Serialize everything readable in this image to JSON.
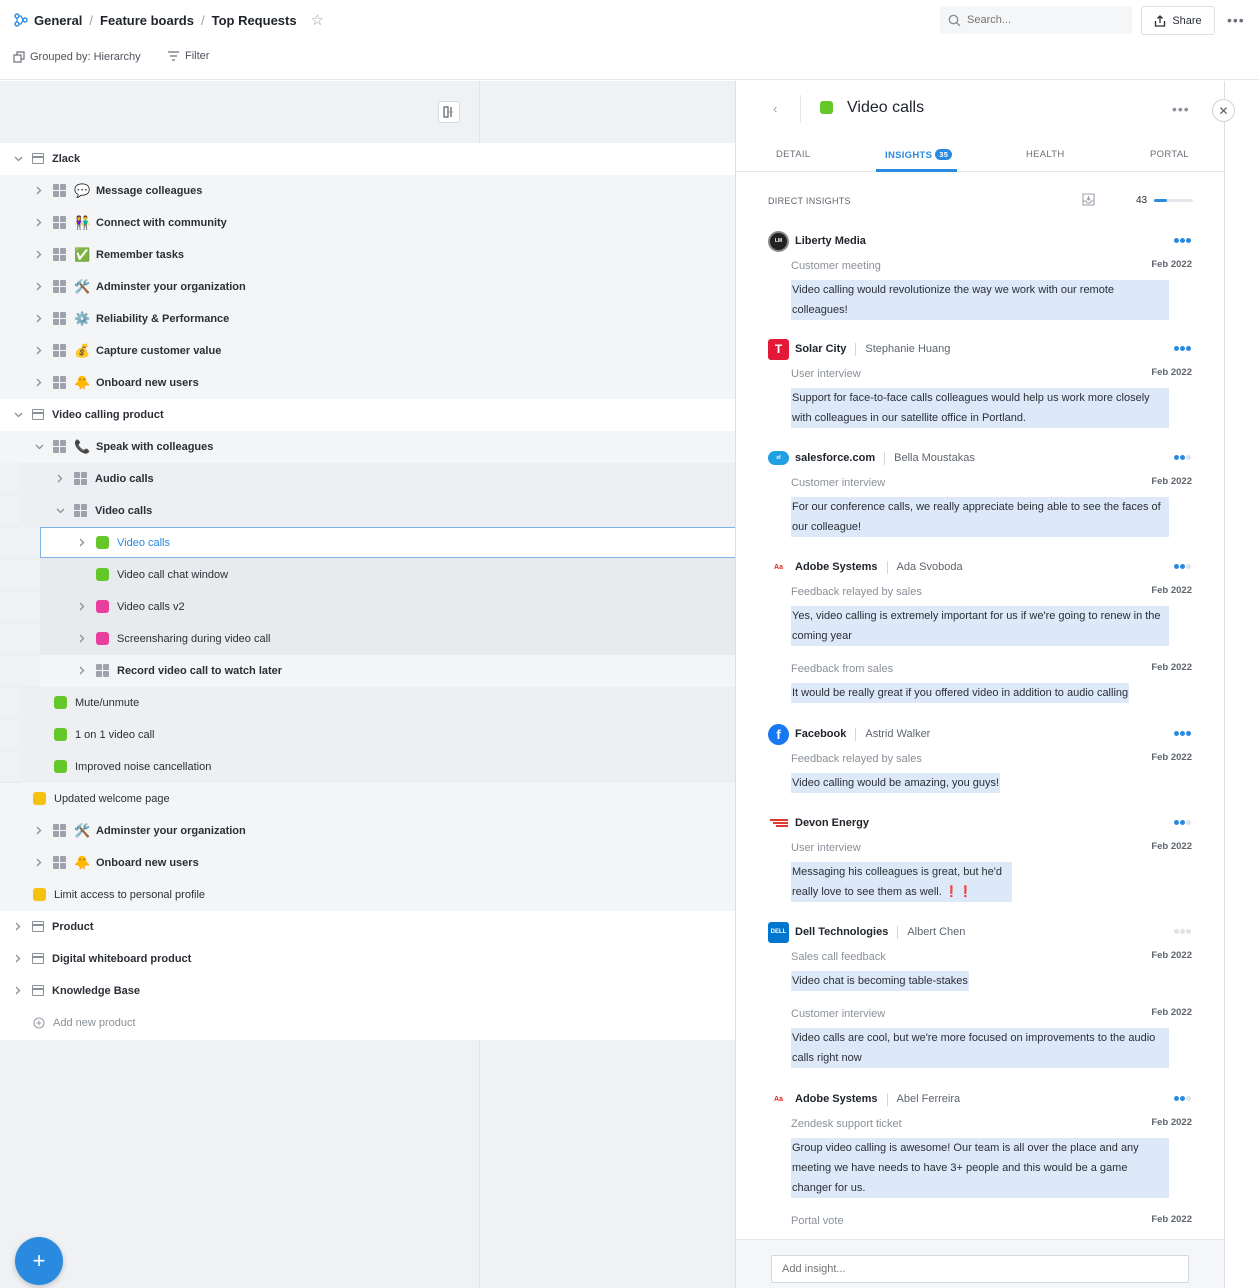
{
  "breadcrumb": [
    "General",
    "Feature boards",
    "Top Requests"
  ],
  "search": {
    "placeholder": "Search..."
  },
  "share_label": "Share",
  "grouped_label": "Grouped by: Hierarchy",
  "filter_label": "Filter",
  "tree": [
    {
      "label": "Zlack",
      "kind": "product",
      "depth": 0,
      "expanded": true,
      "bold": true
    },
    {
      "label": "Message colleagues",
      "kind": "component",
      "icon": "💬",
      "depth": 1,
      "bold": true
    },
    {
      "label": "Connect with community",
      "kind": "component",
      "icon": "👫",
      "depth": 1,
      "bold": true
    },
    {
      "label": "Remember tasks",
      "kind": "component",
      "icon": "✅",
      "depth": 1,
      "bold": true
    },
    {
      "label": "Adminster your organization",
      "kind": "component",
      "icon": "🛠️",
      "depth": 1,
      "bold": true
    },
    {
      "label": "Reliability & Performance",
      "kind": "component",
      "icon": "⚙️",
      "depth": 1,
      "bold": true
    },
    {
      "label": "Capture customer value",
      "kind": "component",
      "icon": "💰",
      "depth": 1,
      "bold": true
    },
    {
      "label": "Onboard new users",
      "kind": "component",
      "icon": "🐥",
      "depth": 1,
      "bold": true
    },
    {
      "label": "Video calling product",
      "kind": "product",
      "depth": 0,
      "expanded": true,
      "bold": true
    },
    {
      "label": "Speak with colleagues",
      "kind": "component",
      "icon": "📞",
      "depth": 1,
      "expanded": true,
      "bold": true
    },
    {
      "label": "Audio calls",
      "kind": "component",
      "depth": 2,
      "bold": true
    },
    {
      "label": "Video calls",
      "kind": "component",
      "depth": 2,
      "expanded": true,
      "bold": true
    },
    {
      "label": "Video calls",
      "kind": "feature",
      "color": "#65c82a",
      "depth": 3,
      "selected": true,
      "chevron": true
    },
    {
      "label": "Video call chat window",
      "kind": "feature",
      "color": "#65c82a",
      "depth": 3
    },
    {
      "label": "Video calls v2",
      "kind": "feature",
      "color": "#e83e9e",
      "depth": 3,
      "chevron": true
    },
    {
      "label": "Screensharing during video call",
      "kind": "feature",
      "color": "#e83e9e",
      "depth": 3,
      "chevron": true
    },
    {
      "label": "Record video call to watch later",
      "kind": "component",
      "depth": 3,
      "bold": true,
      "chevron": true
    },
    {
      "label": "Mute/unmute",
      "kind": "feature",
      "color": "#65c82a",
      "depth": 2
    },
    {
      "label": "1 on 1 video call",
      "kind": "feature",
      "color": "#65c82a",
      "depth": 2
    },
    {
      "label": "Improved noise cancellation",
      "kind": "feature",
      "color": "#65c82a",
      "depth": 2
    },
    {
      "label": "Updated welcome page",
      "kind": "feature",
      "color": "#f5c211",
      "depth": 1
    },
    {
      "label": "Adminster your organization",
      "kind": "component",
      "icon": "🛠️",
      "depth": 1,
      "bold": true
    },
    {
      "label": "Onboard new users",
      "kind": "component",
      "icon": "🐥",
      "depth": 1,
      "bold": true
    },
    {
      "label": "Limit access to personal profile",
      "kind": "feature",
      "color": "#f5c211",
      "depth": 1
    },
    {
      "label": "Product",
      "kind": "product",
      "depth": 0,
      "bold": true
    },
    {
      "label": "Digital whiteboard product",
      "kind": "product",
      "depth": 0,
      "bold": true
    },
    {
      "label": "Knowledge Base",
      "kind": "product",
      "depth": 0,
      "bold": true
    }
  ],
  "add_new_product": "Add new product",
  "panel": {
    "title": "Video calls",
    "title_color": "#65c82a",
    "tabs": [
      {
        "label": "DETAIL"
      },
      {
        "label": "INSIGHTS",
        "count": "35",
        "active": true
      },
      {
        "label": "HEALTH"
      },
      {
        "label": "PORTAL"
      }
    ],
    "direct_insights_label": "DIRECT INSIGHTS",
    "direct_insights_count": "43",
    "direct_insights_fraction": 0.33,
    "add_insight_placeholder": "Add insight..."
  },
  "insights": [
    {
      "company": "Liberty Media",
      "person": "",
      "logo": "liberty",
      "importance": 3,
      "notes": [
        {
          "source": "Customer meeting",
          "date": "Feb 2022",
          "text": "Video calling would revolutionize the way we work with our remote colleagues!",
          "wide": true
        }
      ]
    },
    {
      "company": "Solar City",
      "person": "Stephanie Huang",
      "logo": "tesla",
      "importance": 3,
      "notes": [
        {
          "source": "User interview",
          "date": "Feb 2022",
          "text": "Support for face-to-face calls colleagues would help us work more closely with colleagues in our satellite office in Portland.",
          "wide": true
        }
      ]
    },
    {
      "company": "salesforce.com",
      "person": "Bella Moustakas",
      "logo": "salesforce",
      "importance": 2,
      "notes": [
        {
          "source": "Customer interview",
          "date": "Feb 2022",
          "text": "For our conference calls, we really appreciate being able to see the faces of our colleague!",
          "wide": true
        }
      ]
    },
    {
      "company": "Adobe Systems",
      "person": "Ada Svoboda",
      "logo": "adobe",
      "importance": 2,
      "notes": [
        {
          "source": "Feedback relayed by sales",
          "date": "Feb 2022",
          "text": "Yes, video calling is extremely important for us if we're going to renew in the coming year",
          "wide": true
        },
        {
          "source": "Feedback from sales",
          "date": "Feb 2022",
          "text": "It would be really great if you offered video in addition to audio calling",
          "wide": false
        }
      ]
    },
    {
      "company": "Facebook",
      "person": "Astrid Walker",
      "logo": "facebook",
      "importance": 3,
      "notes": [
        {
          "source": "Feedback relayed by sales",
          "date": "Feb 2022",
          "text": "Video calling would be amazing, you guys!",
          "wide": false
        }
      ]
    },
    {
      "company": "Devon Energy",
      "person": "",
      "logo": "devon",
      "importance": 2,
      "notes": [
        {
          "source": "User interview",
          "date": "Feb 2022",
          "text": "Messaging his colleagues is great, but he'd really love to see them as well. ❗❗",
          "wide": false
        }
      ]
    },
    {
      "company": "Dell Technologies",
      "person": "Albert Chen",
      "logo": "dell",
      "importance": 0,
      "notes": [
        {
          "source": "Sales call feedback",
          "date": "Feb 2022",
          "text": "Video chat is becoming table-stakes",
          "wide": false
        },
        {
          "source": "Customer interview",
          "date": "Feb 2022",
          "text": "Video calls are cool, but we're more focused on improvements to the audio calls right now",
          "wide": true
        }
      ]
    },
    {
      "company": "Adobe Systems",
      "person": "Abel Ferreira",
      "logo": "adobe",
      "importance": 2,
      "notes": [
        {
          "source": "Zendesk support ticket",
          "date": "Feb 2022",
          "text": "Group video calling is awesome! Our team is all over the place and any meeting we have needs to have 3+ people and this would be a game changer for us.",
          "wide": true
        },
        {
          "source": "Portal vote",
          "date": "Feb 2022",
          "text": "",
          "wide": false
        }
      ]
    }
  ],
  "colors": {
    "accent": "#2a8ae0",
    "highlight": "#dde9f9"
  }
}
